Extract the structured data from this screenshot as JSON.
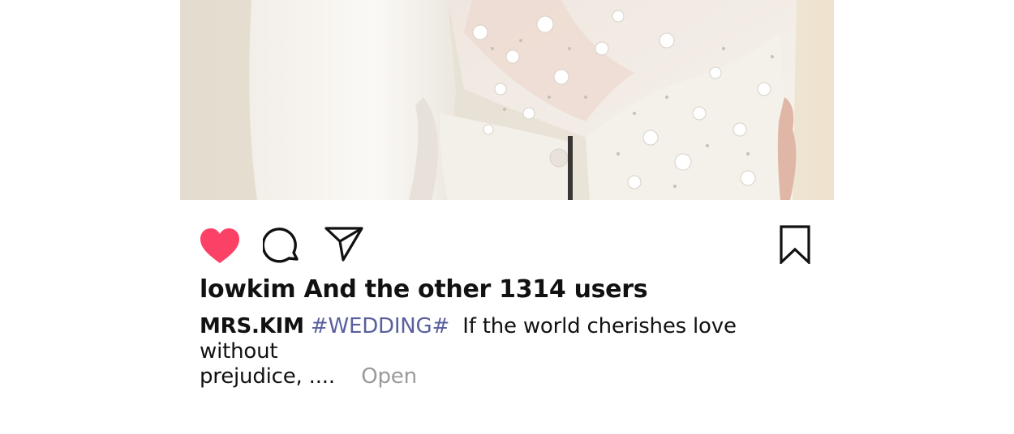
{
  "post": {
    "image_alt": "Wedding dress with sequined lace bodice",
    "actions": {
      "like_icon": "heart-filled-icon",
      "comment_icon": "comment-bubble-icon",
      "share_icon": "paper-plane-icon",
      "bookmark_icon": "bookmark-icon",
      "like_color": "#fb4266"
    },
    "likes_text": "lowkim And the other 1314 users",
    "caption": {
      "username": "MRS.KIM",
      "hashtag": "#WEDDING#",
      "text_line1": "If the world cherishes love without",
      "text_line2": "prejudice, ....",
      "more_label": "Open"
    },
    "colors": {
      "hashtag": "#5a5f9e",
      "muted": "#9a9a9a"
    }
  }
}
